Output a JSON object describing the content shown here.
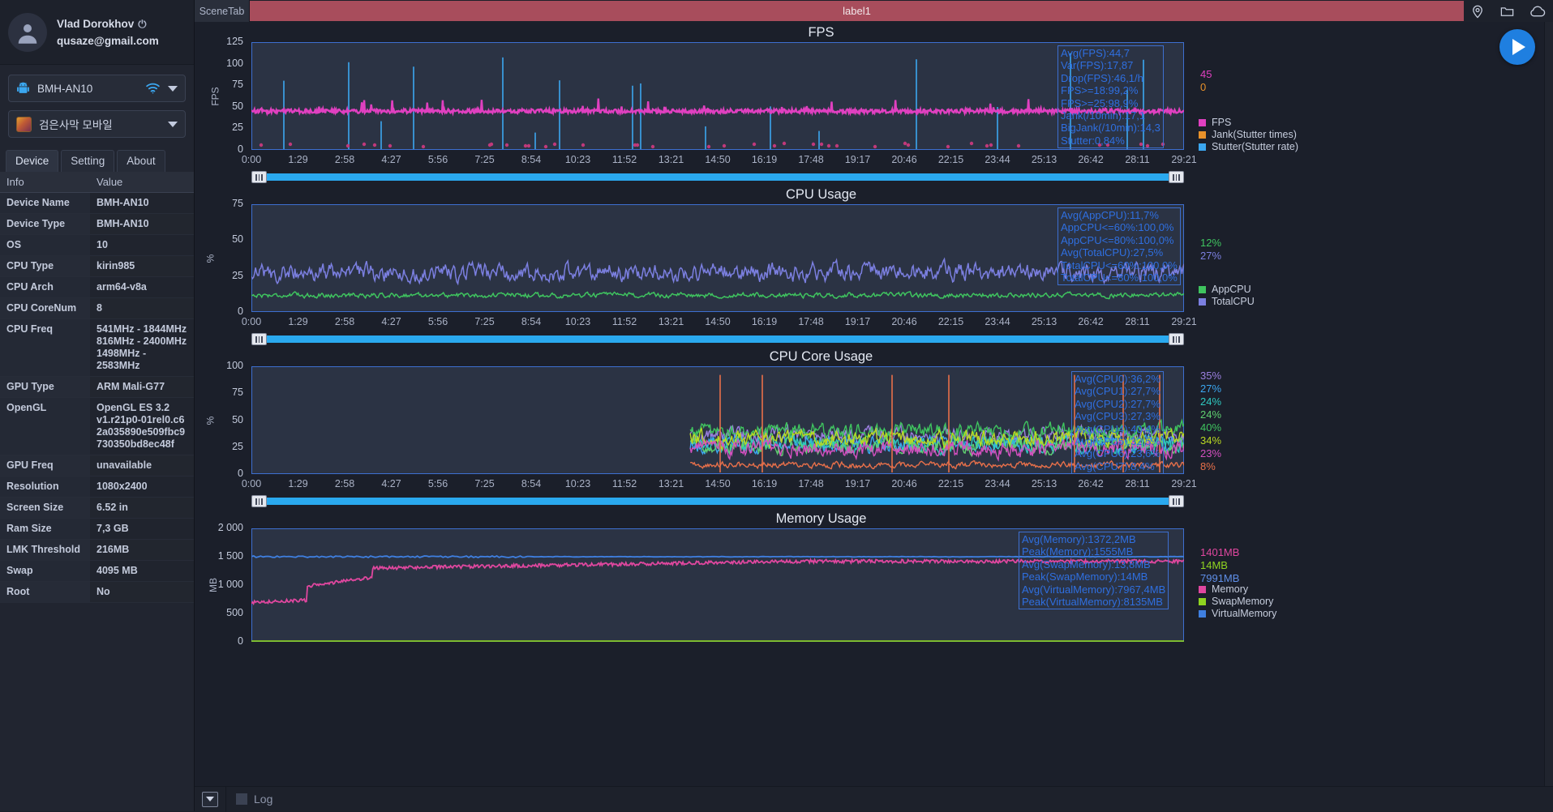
{
  "account": {
    "name": "Vlad Dorokhov",
    "power_icon": "power-icon",
    "email": "qusaze@gmail.com"
  },
  "device_selector": {
    "label": "BMH-AN10",
    "icon": "android-icon",
    "status_icon": "wifi-icon"
  },
  "app_selector": {
    "label": "검은사막 모바일",
    "icon": "game-app-icon"
  },
  "tabs": [
    {
      "label": "Device",
      "active": true
    },
    {
      "label": "Setting",
      "active": false
    },
    {
      "label": "About",
      "active": false
    }
  ],
  "info_table": {
    "headers": [
      "Info",
      "Value"
    ],
    "rows": [
      {
        "key": "Device Name",
        "value": "BMH-AN10"
      },
      {
        "key": "Device Type",
        "value": "BMH-AN10"
      },
      {
        "key": "OS",
        "value": "10"
      },
      {
        "key": "CPU Type",
        "value": "kirin985"
      },
      {
        "key": "CPU Arch",
        "value": "arm64-v8a"
      },
      {
        "key": "CPU CoreNum",
        "value": "8"
      },
      {
        "key": "CPU Freq",
        "value": "541MHz - 1844MHz\n816MHz - 2400MHz\n1498MHz -\n2583MHz"
      },
      {
        "key": "GPU Type",
        "value": "ARM Mali-G77"
      },
      {
        "key": "OpenGL",
        "value": "OpenGL ES 3.2\nv1.r21p0-01rel0.c6\n2a035890e509fbc9\n730350bd8ec48f"
      },
      {
        "key": "GPU Freq",
        "value": "unavailable"
      },
      {
        "key": "Resolution",
        "value": "1080x2400"
      },
      {
        "key": "Screen Size",
        "value": "6.52 in"
      },
      {
        "key": "Ram Size",
        "value": "7,3 GB"
      },
      {
        "key": "LMK Threshold",
        "value": "216MB"
      },
      {
        "key": "Swap",
        "value": "4095 MB"
      },
      {
        "key": "Root",
        "value": "No"
      }
    ]
  },
  "topbar": {
    "scene_tab": "SceneTab",
    "label": "label1",
    "icons": [
      "location-pin-icon",
      "folder-icon",
      "cloud-icon"
    ]
  },
  "play_button": {
    "icon": "play-icon"
  },
  "bottombar": {
    "dropdown_icon": "chevron-down-icon",
    "log_label": "Log"
  },
  "colors": {
    "accent_blue": "#2f6fe0",
    "scroll_blue": "#2aa9ef",
    "label_bar": "#a84d5c",
    "fps_pink": "#e040c0",
    "jank_orange": "#e8912a",
    "stutter_blue": "#3ba7f0",
    "appcpu_green": "#3fc45f",
    "totalcpu_violet": "#7b7fe0",
    "memory_pink": "#e0479f",
    "swap_green": "#8fd420",
    "virtual_blue": "#3f7fe0"
  },
  "chart_data": [
    {
      "type": "line",
      "title": "FPS",
      "ylabel": "FPS",
      "xlabel": "",
      "ylim": [
        0,
        125
      ],
      "yticks": [
        0,
        25,
        50,
        75,
        100,
        125
      ],
      "xticks": [
        "0:00",
        "1:29",
        "2:58",
        "4:27",
        "5:56",
        "7:25",
        "8:54",
        "10:23",
        "11:52",
        "13:21",
        "14:50",
        "16:19",
        "17:48",
        "19:17",
        "20:46",
        "22:15",
        "23:44",
        "25:13",
        "26:42",
        "28:11",
        "29:21"
      ],
      "grid": false,
      "stats": [
        "Avg(FPS):44,7",
        "Var(FPS):17,87",
        "Drop(FPS):46,1/h",
        "FPS>=18:99,2%",
        "FPS>=25:98,9%",
        "Jank(/10min):17,1",
        "BigJank(/10min):14,3",
        "Stutter:0,84%"
      ],
      "current_values": [
        {
          "label": "45",
          "color": "#e040c0"
        },
        {
          "label": "0",
          "color": "#e8912a"
        }
      ],
      "legend": [
        {
          "name": "FPS",
          "color": "#e040c0"
        },
        {
          "name": "Jank(Stutter times)",
          "color": "#e8912a"
        },
        {
          "name": "Stutter(Stutter rate)",
          "color": "#3ba7f0"
        }
      ],
      "series": [
        {
          "name": "FPS",
          "color": "#e040c0",
          "mean": 44.7
        },
        {
          "name": "Jank(Stutter times)",
          "color": "#e8912a",
          "mean": 0
        },
        {
          "name": "Stutter(Stutter rate)",
          "color": "#3ba7f0",
          "mean": 0.84
        }
      ]
    },
    {
      "type": "line",
      "title": "CPU Usage",
      "ylabel": "%",
      "xlabel": "",
      "ylim": [
        0,
        75
      ],
      "yticks": [
        0,
        25,
        50,
        75
      ],
      "xticks": [
        "0:00",
        "1:29",
        "2:58",
        "4:27",
        "5:56",
        "7:25",
        "8:54",
        "10:23",
        "11:52",
        "13:21",
        "14:50",
        "16:19",
        "17:48",
        "19:17",
        "20:46",
        "22:15",
        "23:44",
        "25:13",
        "26:42",
        "28:11",
        "29:21"
      ],
      "grid": false,
      "stats": [
        "Avg(AppCPU):11,7%",
        "AppCPU<=60%:100,0%",
        "AppCPU<=80%:100,0%",
        "Avg(TotalCPU):27,5%",
        "TotalCPU<=60%:100,0%",
        "TotalCPU<=80%:100,0%"
      ],
      "current_values": [
        {
          "label": "12%",
          "color": "#3fc45f"
        },
        {
          "label": "27%",
          "color": "#7b7fe0"
        }
      ],
      "legend": [
        {
          "name": "AppCPU",
          "color": "#3fc45f"
        },
        {
          "name": "TotalCPU",
          "color": "#7b7fe0"
        }
      ],
      "series": [
        {
          "name": "AppCPU",
          "color": "#3fc45f",
          "mean": 11.7
        },
        {
          "name": "TotalCPU",
          "color": "#7b7fe0",
          "mean": 27.5
        }
      ]
    },
    {
      "type": "line",
      "title": "CPU Core Usage",
      "ylabel": "%",
      "xlabel": "",
      "ylim": [
        0,
        100
      ],
      "yticks": [
        0,
        25,
        50,
        75,
        100
      ],
      "xticks": [
        "0:00",
        "1:29",
        "2:58",
        "4:27",
        "5:56",
        "7:25",
        "8:54",
        "10:23",
        "11:52",
        "13:21",
        "14:50",
        "16:19",
        "17:48",
        "19:17",
        "20:46",
        "22:15",
        "23:44",
        "25:13",
        "26:42",
        "28:11",
        "29:21"
      ],
      "grid": false,
      "stats": [
        "Avg(CPU0):36,2%",
        "Avg(CPU1):27,7%",
        "Avg(CPU2):27,7%",
        "Avg(CPU3):27,3%",
        "Avg(CPU4):40,4%",
        "Avg(CPU5):32,5%",
        "Avg(CPU6):23,6%",
        "Avg(CPU7):8,4%"
      ],
      "current_values": [
        {
          "label": "35%",
          "color": "#9b7fe0"
        },
        {
          "label": "27%",
          "color": "#3ba7f0"
        },
        {
          "label": "24%",
          "color": "#2fc9c0"
        },
        {
          "label": "24%",
          "color": "#5fd070"
        },
        {
          "label": "40%",
          "color": "#3fc45f"
        },
        {
          "label": "34%",
          "color": "#bada22"
        },
        {
          "label": "23%",
          "color": "#d450c0"
        },
        {
          "label": "8%",
          "color": "#e8704a"
        }
      ],
      "legend": [],
      "series": [
        {
          "name": "CPU0",
          "color": "#9b7fe0",
          "mean": 36.2
        },
        {
          "name": "CPU1",
          "color": "#3ba7f0",
          "mean": 27.7
        },
        {
          "name": "CPU2",
          "color": "#2fc9c0",
          "mean": 27.7
        },
        {
          "name": "CPU3",
          "color": "#5fd070",
          "mean": 27.3
        },
        {
          "name": "CPU4",
          "color": "#3fc45f",
          "mean": 40.4
        },
        {
          "name": "CPU5",
          "color": "#bada22",
          "mean": 32.5
        },
        {
          "name": "CPU6",
          "color": "#d450c0",
          "mean": 23.6
        },
        {
          "name": "CPU7",
          "color": "#e8704a",
          "mean": 8.4
        }
      ]
    },
    {
      "type": "line",
      "title": "Memory Usage",
      "ylabel": "MB",
      "xlabel": "",
      "ylim": [
        0,
        2000
      ],
      "yticks": [
        0,
        500,
        1000,
        1500,
        2000
      ],
      "ytick_labels": [
        "0",
        "500",
        "1 000",
        "1 500",
        "2 000"
      ],
      "xticks": [],
      "grid": false,
      "stats": [
        "Avg(Memory):1372,2MB",
        "Peak(Memory):1555MB",
        "Avg(SwapMemory):13,8MB",
        "Peak(SwapMemory):14MB",
        "Avg(VirtualMemory):7967,4MB",
        "Peak(VirtualMemory):8135MB"
      ],
      "current_values": [
        {
          "label": "1401MB",
          "color": "#e0479f"
        },
        {
          "label": "14MB",
          "color": "#8fd420"
        },
        {
          "label": "7991MB",
          "color": "#5f8fe8"
        }
      ],
      "legend": [
        {
          "name": "Memory",
          "color": "#e0479f"
        },
        {
          "name": "SwapMemory",
          "color": "#8fd420"
        },
        {
          "name": "VirtualMemory",
          "color": "#3f7fe0"
        }
      ],
      "series": [
        {
          "name": "Memory",
          "color": "#e0479f",
          "mean": 1372.2,
          "peak": 1555
        },
        {
          "name": "SwapMemory",
          "color": "#8fd420",
          "mean": 13.8,
          "peak": 14
        },
        {
          "name": "VirtualMemory",
          "color": "#3f7fe0",
          "mean": 7967.4,
          "peak": 8135
        }
      ]
    }
  ]
}
